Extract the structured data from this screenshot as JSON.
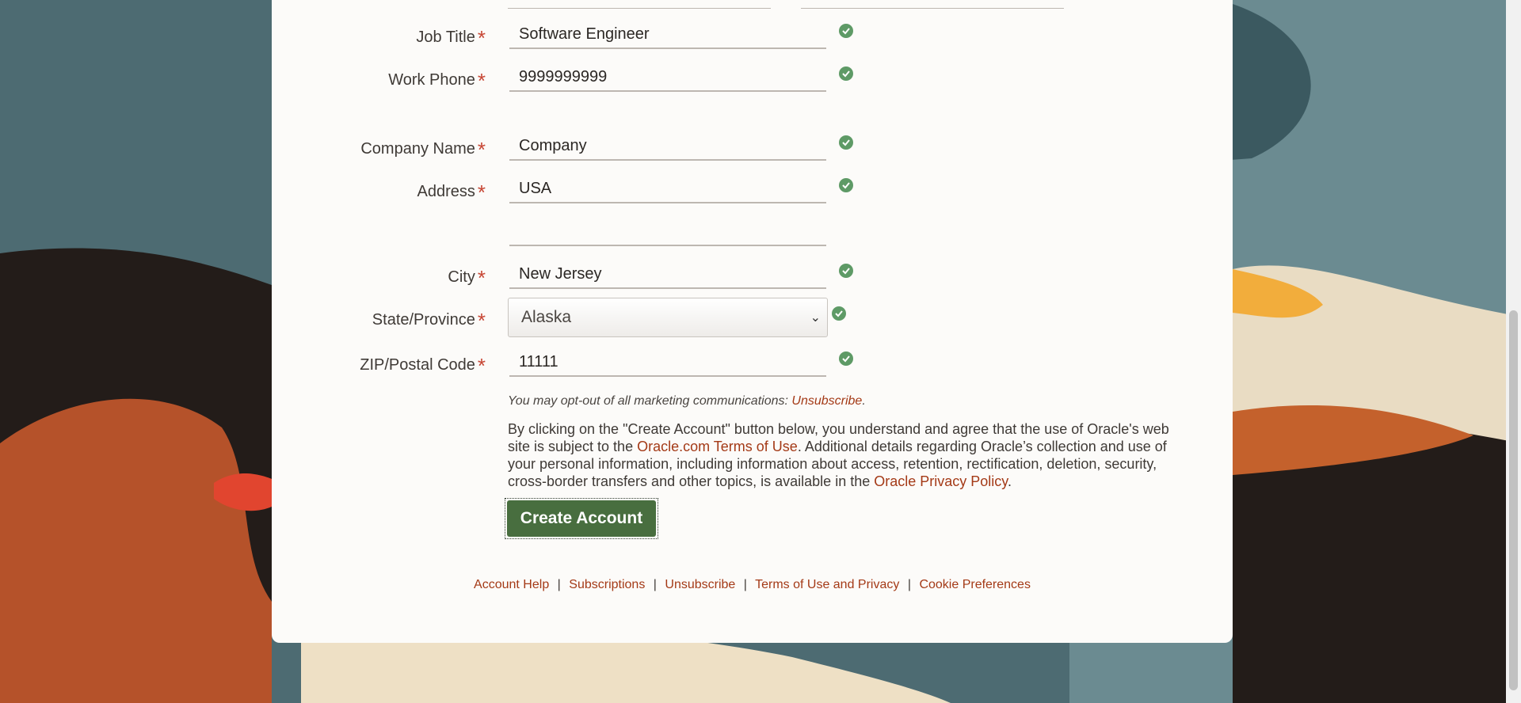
{
  "colors": {
    "accent_link": "#a43a17",
    "required_star": "#c74634",
    "valid_check": "#5e9a66",
    "primary_button": "#486e3f"
  },
  "form": {
    "fields": [
      {
        "label": "Job Title",
        "value": "Software Engineer"
      },
      {
        "label": "Work Phone",
        "value": "9999999999"
      },
      {
        "label": "Company Name",
        "value": "Company"
      },
      {
        "label": "Address",
        "value": "USA"
      },
      {
        "label": "",
        "value": ""
      },
      {
        "label": "City",
        "value": "New Jersey"
      },
      {
        "label": "State/Province",
        "value": "Alaska"
      },
      {
        "label": "ZIP/Postal Code",
        "value": "11111"
      }
    ],
    "required_marker": "*"
  },
  "optout": {
    "text": "You may opt-out of all marketing communications: ",
    "link": "Unsubscribe",
    "period": "."
  },
  "consent": {
    "p1": "By clicking on the \"Create Account\" button below, you understand and agree that the use of Oracle's web site is subject to the ",
    "terms_link": "Oracle.com Terms of Use",
    "p2": ". Additional details regarding Oracle’s collection and use of your personal information, including information about access, retention, rectification, deletion, security, cross-border transfers and other topics, is available in the ",
    "privacy_link": "Oracle Privacy Policy",
    "p3": "."
  },
  "button": {
    "label": "Create Account"
  },
  "footer": {
    "links": [
      "Account Help",
      "Subscriptions",
      "Unsubscribe",
      "Terms of Use and Privacy",
      "Cookie Preferences"
    ],
    "separator": "|"
  },
  "icons": {
    "valid": "check-circle-icon",
    "select_arrow": "chevron-down-icon"
  }
}
